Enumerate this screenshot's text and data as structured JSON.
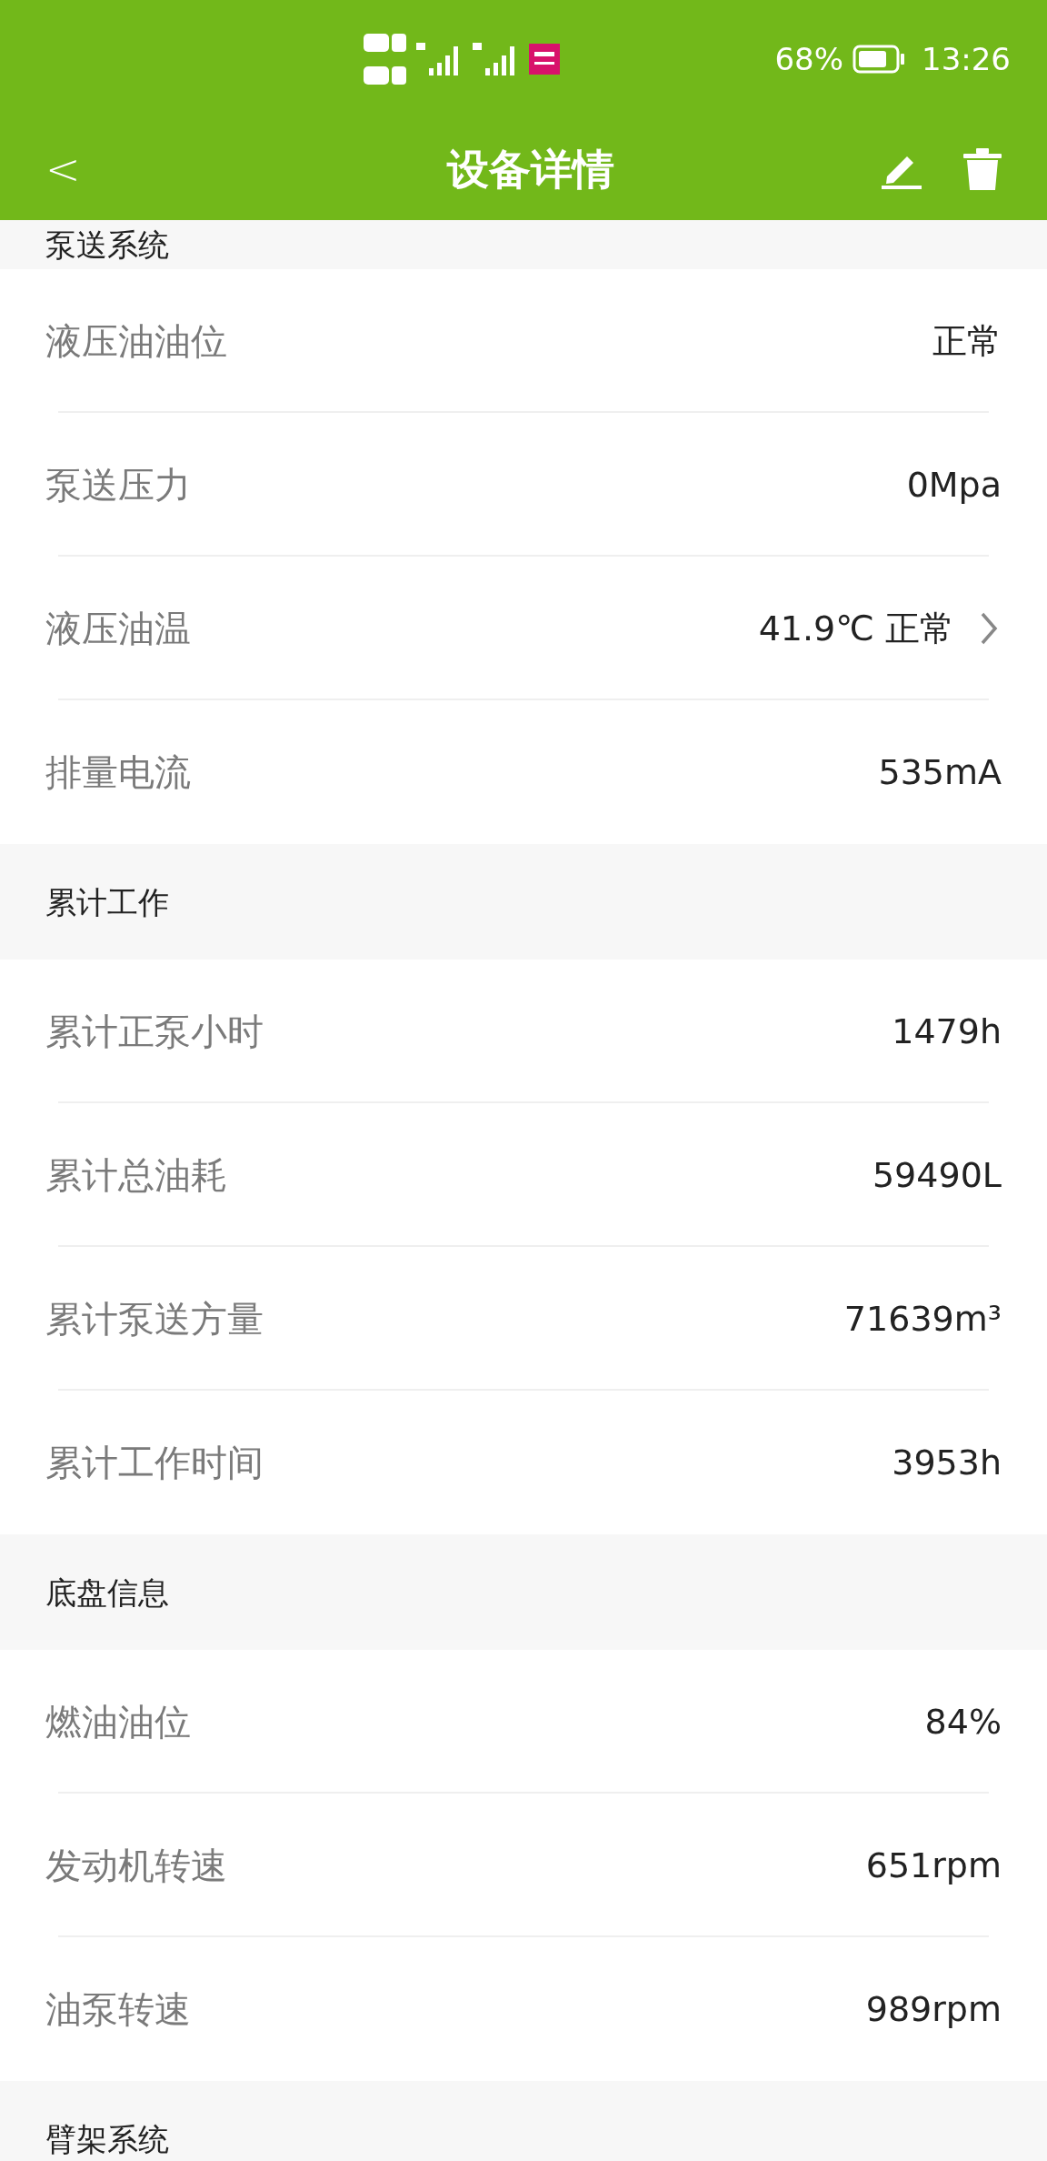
{
  "status_bar": {
    "battery": "68%",
    "time": "13:26"
  },
  "header": {
    "title": "设备详情",
    "back": "<"
  },
  "sections": [
    {
      "title": "泵送系统",
      "rows": [
        {
          "label": "液压油油位",
          "value": "正常",
          "chevron": false
        },
        {
          "label": "泵送压力",
          "value": "0Mpa",
          "chevron": false
        },
        {
          "label": "液压油温",
          "value": "41.9℃ 正常",
          "chevron": true
        },
        {
          "label": "排量电流",
          "value": "535mA",
          "chevron": false
        }
      ]
    },
    {
      "title": "累计工作",
      "rows": [
        {
          "label": "累计正泵小时",
          "value": "1479h",
          "chevron": false
        },
        {
          "label": "累计总油耗",
          "value": "59490L",
          "chevron": false
        },
        {
          "label": "累计泵送方量",
          "value": "71639m³",
          "chevron": false
        },
        {
          "label": "累计工作时间",
          "value": "3953h",
          "chevron": false
        }
      ]
    },
    {
      "title": "底盘信息",
      "rows": [
        {
          "label": "燃油油位",
          "value": "84%",
          "chevron": false
        },
        {
          "label": "发动机转速",
          "value": "651rpm",
          "chevron": false
        },
        {
          "label": "油泵转速",
          "value": "989rpm",
          "chevron": false
        }
      ]
    },
    {
      "title": "臂架系统"
    }
  ]
}
